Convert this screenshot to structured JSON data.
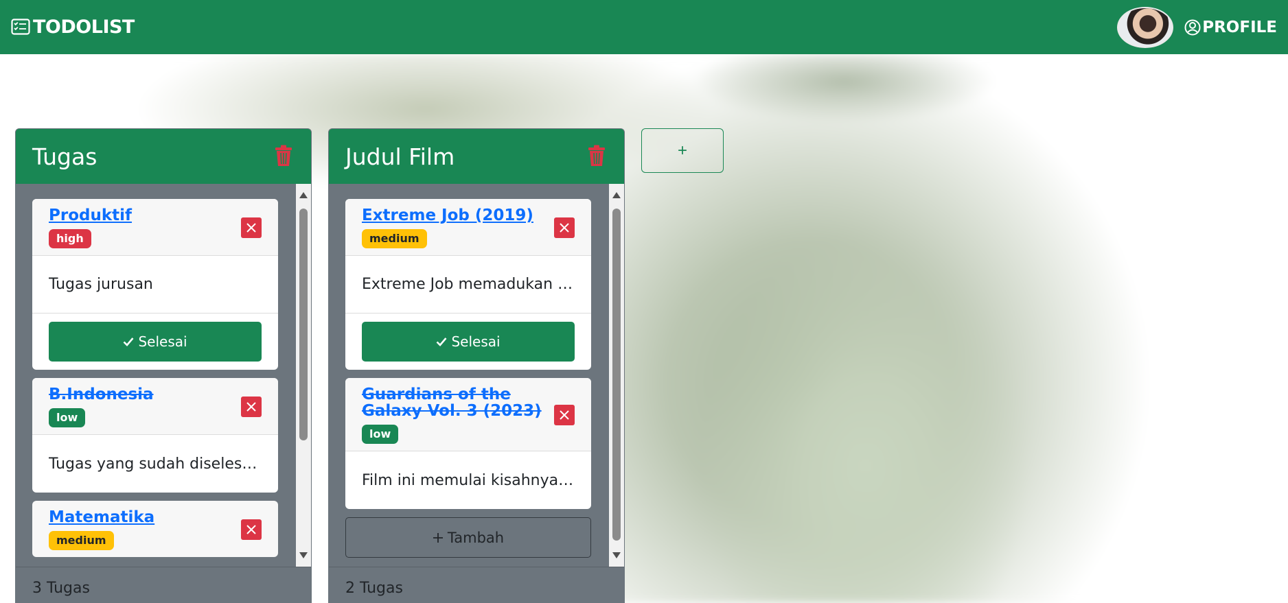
{
  "navbar": {
    "brand": "TODOLIST",
    "profile_label": "PROFILE",
    "brand_icon": "checklist-icon",
    "profile_icon": "person-circle-icon"
  },
  "columns": [
    {
      "title": "Tugas",
      "footer": "3 Tugas",
      "cards": [
        {
          "title": "Produktif",
          "priority": "high",
          "description": "Tugas jurusan",
          "done_label": "Selesai",
          "completed": false
        },
        {
          "title": "B.Indonesia",
          "priority": "low",
          "description": "Tugas yang sudah diselesaikan",
          "completed": true
        },
        {
          "title": "Matematika",
          "priority": "medium",
          "description": "",
          "completed": false
        }
      ]
    },
    {
      "title": "Judul Film",
      "footer": "2 Tugas",
      "add_label": "Tambah",
      "cards": [
        {
          "title": "Extreme Job (2019)",
          "priority": "medium",
          "description": "Extreme Job memadukan e...",
          "done_label": "Selesai",
          "completed": false
        },
        {
          "title": "Guardians of the Galaxy Vol. 3 (2023)",
          "priority": "low",
          "description": "Film ini memulai kisahnya ...",
          "completed": true
        }
      ]
    }
  ],
  "add_column_label": "+",
  "colors": {
    "primary_green": "#198754",
    "danger": "#dc3545",
    "warning": "#ffc107",
    "link": "#0d6efd",
    "column_bg": "#6c757d"
  }
}
